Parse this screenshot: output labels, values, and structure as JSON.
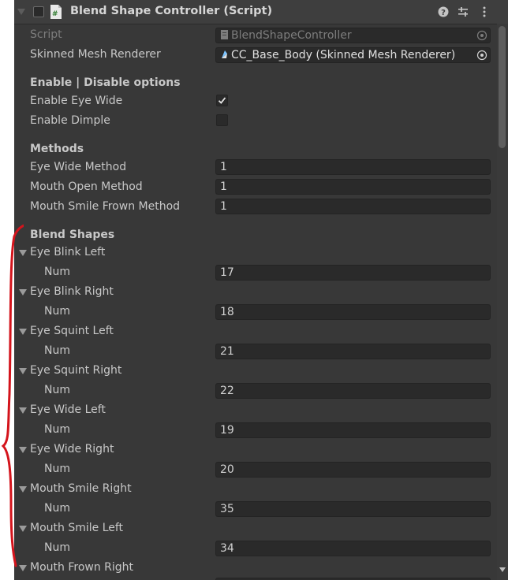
{
  "header": {
    "title": "Blend Shape Controller (Script)"
  },
  "fields": {
    "script_label": "Script",
    "script_value": "BlendShapeController",
    "mesh_label": "Skinned Mesh Renderer",
    "mesh_value": "CC_Base_Body (Skinned Mesh Renderer)"
  },
  "options": {
    "heading": "Enable | Disable options",
    "eye_wide_label": "Enable Eye Wide",
    "eye_wide_checked": true,
    "dimple_label": "Enable Dimple",
    "dimple_checked": false
  },
  "methods": {
    "heading": "Methods",
    "items": [
      {
        "label": "Eye Wide Method",
        "value": "1"
      },
      {
        "label": "Mouth Open Method",
        "value": "1"
      },
      {
        "label": "Mouth Smile Frown Method",
        "value": "1"
      }
    ]
  },
  "blend_shapes": {
    "heading": "Blend Shapes",
    "num_label": "Num",
    "items": [
      {
        "label": "Eye Blink Left",
        "num": "17"
      },
      {
        "label": "Eye Blink Right",
        "num": "18"
      },
      {
        "label": "Eye Squint Left",
        "num": "21"
      },
      {
        "label": "Eye Squint Right",
        "num": "22"
      },
      {
        "label": "Eye Wide Left",
        "num": "19"
      },
      {
        "label": "Eye Wide Right",
        "num": "20"
      },
      {
        "label": "Mouth Smile Right",
        "num": "35"
      },
      {
        "label": "Mouth Smile Left",
        "num": "34"
      },
      {
        "label": "Mouth Frown Right",
        "num": ""
      }
    ]
  },
  "colors": {
    "panel_bg": "#383838",
    "field_bg": "#2a2a2a",
    "annotation": "#d4141c"
  }
}
